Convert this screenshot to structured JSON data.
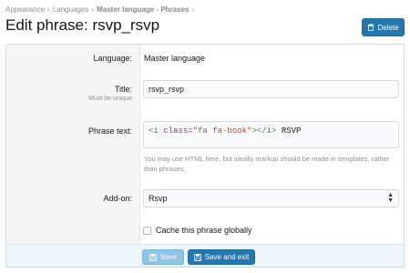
{
  "breadcrumb": {
    "items": [
      "Appearance",
      "Languages",
      "Master language - Phrases"
    ]
  },
  "header": {
    "title": "Edit phrase: rsvp_rsvp",
    "delete_label": "Delete"
  },
  "form": {
    "language": {
      "label": "Language:",
      "value": "Master language"
    },
    "title": {
      "label": "Title:",
      "hint": "Must be unique",
      "value": "rsvp_rsvp"
    },
    "phrase_text": {
      "label": "Phrase text:",
      "code_tag_open": "<i",
      "code_attr": "class=",
      "code_string": "\"fa fa-book\"",
      "code_tag_close": "></i>",
      "code_text": "RSVP",
      "explain": "You may use HTML here, but ideally markup should be made in templates, rather than phrases."
    },
    "addon": {
      "label": "Add-on:",
      "selected": "Rsvp"
    },
    "cache": {
      "label": "Cache this phrase globally",
      "checked": false
    }
  },
  "footer": {
    "save_label": "Save",
    "save_exit_label": "Save and exit"
  },
  "colors": {
    "accent": "#2577b1",
    "footer_bg": "#edf6fd"
  }
}
